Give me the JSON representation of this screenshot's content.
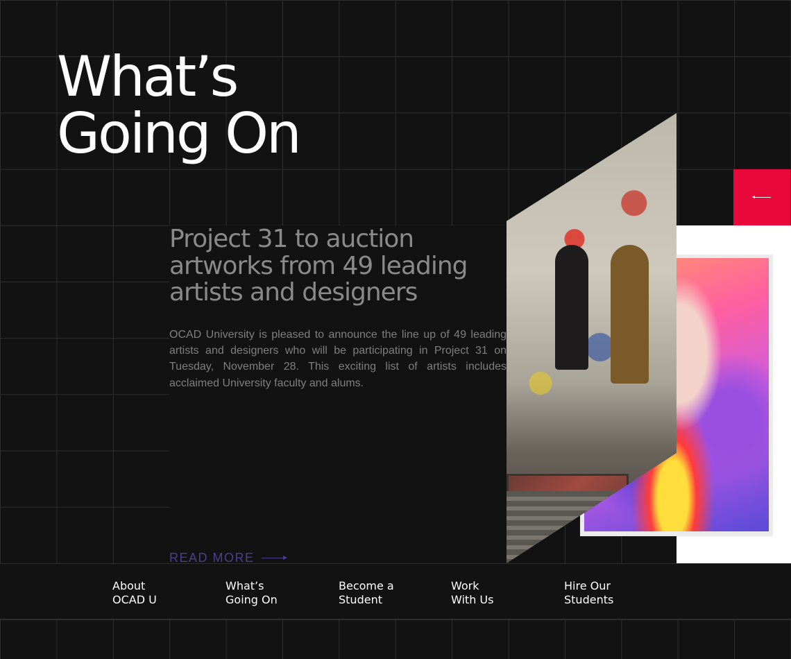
{
  "hero": {
    "title_line1": "What’s",
    "title_line2": "Going On"
  },
  "feature": {
    "headline": "Project 31 to auction artworks from 49 leading artists and designers",
    "body": "OCAD University is pleased to announce the line up of 49 leading artists and designers who will be participating in Project 31 on Tuesday, November 28. This exciting list of artists includes acclaimed University faculty and alums.",
    "read_more_label": "READ MORE",
    "accent_color": "#4b3f8f"
  },
  "slider": {
    "prev_button_icon": "arrow-left-icon",
    "prev_button_color": "#e8083a"
  },
  "nav": {
    "items": [
      {
        "line1": "About",
        "line2": "OCAD U"
      },
      {
        "line1": "What’s",
        "line2": "Going On"
      },
      {
        "line1": "Become a",
        "line2": "Student"
      },
      {
        "line1": "Work",
        "line2": "With Us"
      },
      {
        "line1": "Hire Our",
        "line2": "Students"
      }
    ]
  }
}
